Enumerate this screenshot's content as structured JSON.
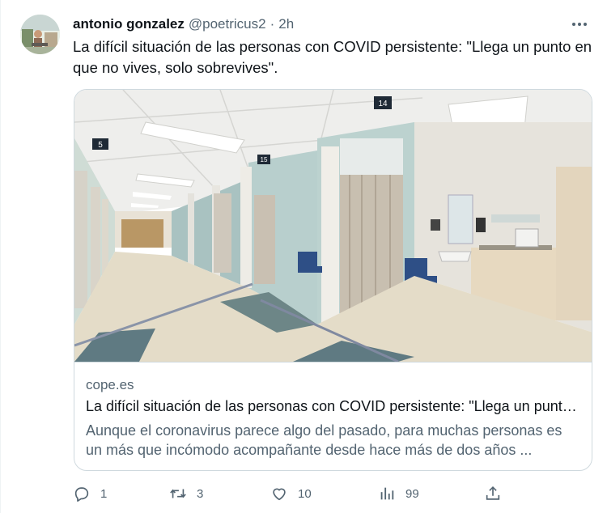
{
  "tweet": {
    "author_name": "antonio gonzalez",
    "handle": "@poetricus2",
    "separator": "·",
    "time": "2h",
    "text": "La difícil situación de las personas con COVID persistente: \"Llega un punto en que no vives, solo sobrevives\"."
  },
  "card": {
    "domain": "cope.es",
    "title": "La difícil situación de las personas con COVID persistente: \"Llega un punto en que no vives, solo sobrevives\"",
    "description": "Aunque el coronavirus parece algo del pasado, para muchas personas es un más que incómodo acompañante desde hace más de dos años ...",
    "image_signs": [
      "5",
      "14",
      "15"
    ]
  },
  "actions": {
    "replies": "1",
    "retweets": "3",
    "likes": "10",
    "views": "99"
  },
  "icons": [
    "more-icon",
    "reply-icon",
    "retweet-icon",
    "like-icon",
    "views-icon",
    "share-icon"
  ],
  "colors": {
    "text_primary": "#0f1419",
    "text_secondary": "#536471",
    "border": "#cfd9de"
  }
}
